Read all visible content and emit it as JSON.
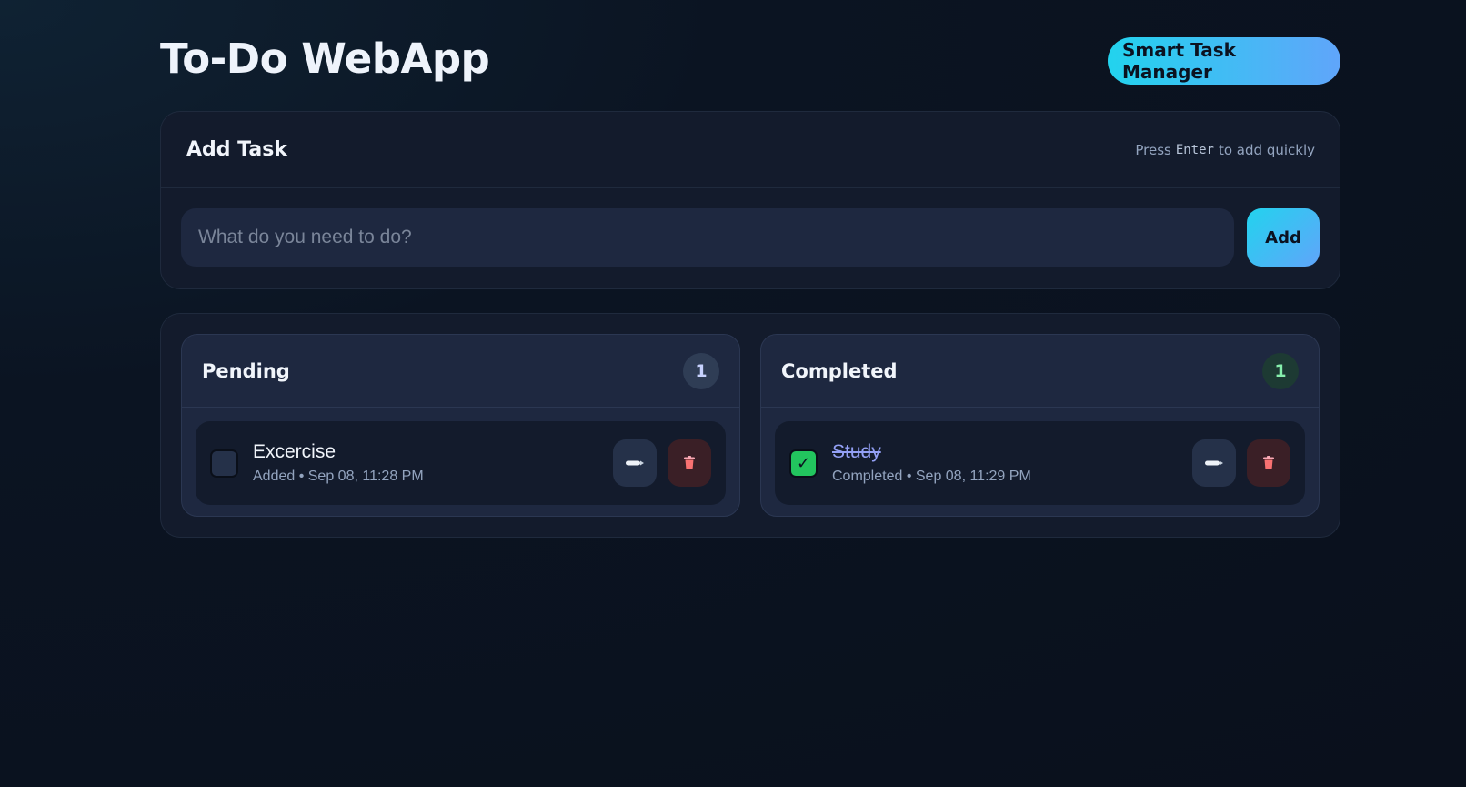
{
  "app": {
    "title": "To-Do WebApp",
    "brand_label": "Smart Task Manager"
  },
  "add_task": {
    "title": "Add Task",
    "hint_prefix": "Press",
    "hint_key": "Enter",
    "hint_suffix": "to add quickly",
    "input_value": "",
    "input_placeholder": "What do you need to do?",
    "add_button_label": "Add"
  },
  "columns": {
    "pending": {
      "title": "Pending",
      "count": "1",
      "tasks": [
        {
          "name": "Excercise",
          "meta": "Added • Sep 08, 11:28 PM",
          "completed": false
        }
      ]
    },
    "completed": {
      "title": "Completed",
      "count": "1",
      "tasks": [
        {
          "name": "Study",
          "meta": "Completed • Sep 08, 11:29 PM",
          "completed": true
        }
      ]
    }
  },
  "icons": {
    "edit": "pencil-icon",
    "delete": "trash-icon",
    "check": "✓"
  },
  "colors": {
    "accent_start": "#22d3ee",
    "accent_end": "#60a5fa",
    "done_green": "#22c55e",
    "delete_red": "#f87171"
  }
}
